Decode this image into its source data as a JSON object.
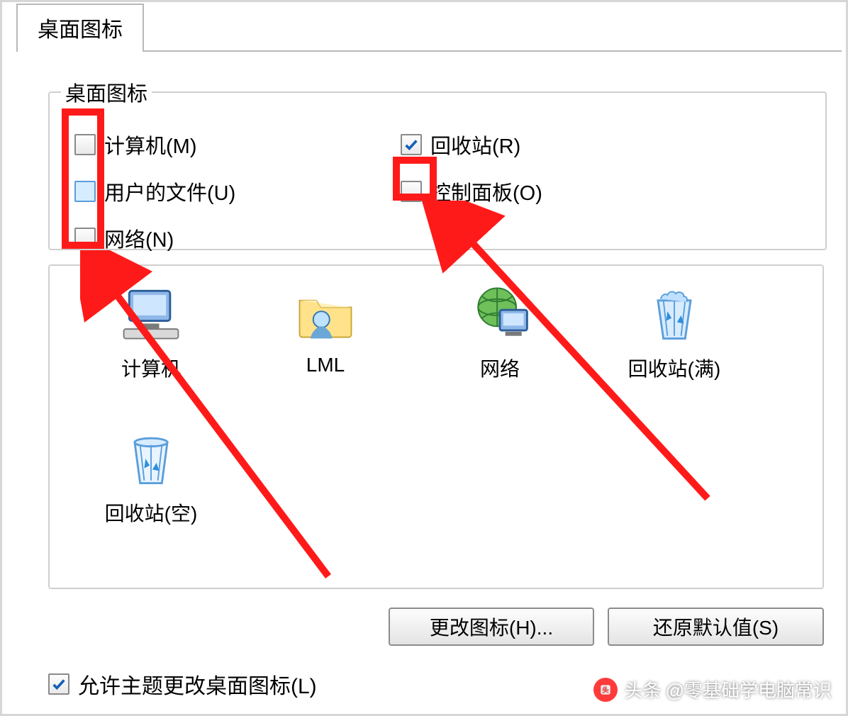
{
  "tab": {
    "label": "桌面图标"
  },
  "group": {
    "legend": "桌面图标",
    "left": [
      {
        "label": "计算机(M)",
        "checked": false,
        "hover": false
      },
      {
        "label": "用户的文件(U)",
        "checked": false,
        "hover": true
      },
      {
        "label": "网络(N)",
        "checked": false,
        "hover": false
      }
    ],
    "right": [
      {
        "label": "回收站(R)",
        "checked": true,
        "hover": false
      },
      {
        "label": "控制面板(O)",
        "checked": false,
        "hover": false
      }
    ]
  },
  "preview": {
    "items": [
      {
        "label": "计算机",
        "icon": "computer"
      },
      {
        "label": "LML",
        "icon": "userfolder"
      },
      {
        "label": "网络",
        "icon": "network"
      },
      {
        "label": "回收站(满)",
        "icon": "recycle-full"
      },
      {
        "label": "回收站(空)",
        "icon": "recycle-empty"
      }
    ]
  },
  "buttons": {
    "change": "更改图标(H)...",
    "reset": "还原默认值(S)"
  },
  "allow": {
    "label": "允许主题更改桌面图标(L)",
    "checked": true
  },
  "watermark": {
    "prefix": "头条",
    "text": "@零基础学电脑常识"
  },
  "annotations": {
    "highlight_left": "red-box-left-checkboxes",
    "highlight_right": "red-box-control-panel-checkbox",
    "arrow_left": "arrow-to-left-checkboxes",
    "arrow_right": "arrow-to-control-panel-checkbox"
  }
}
